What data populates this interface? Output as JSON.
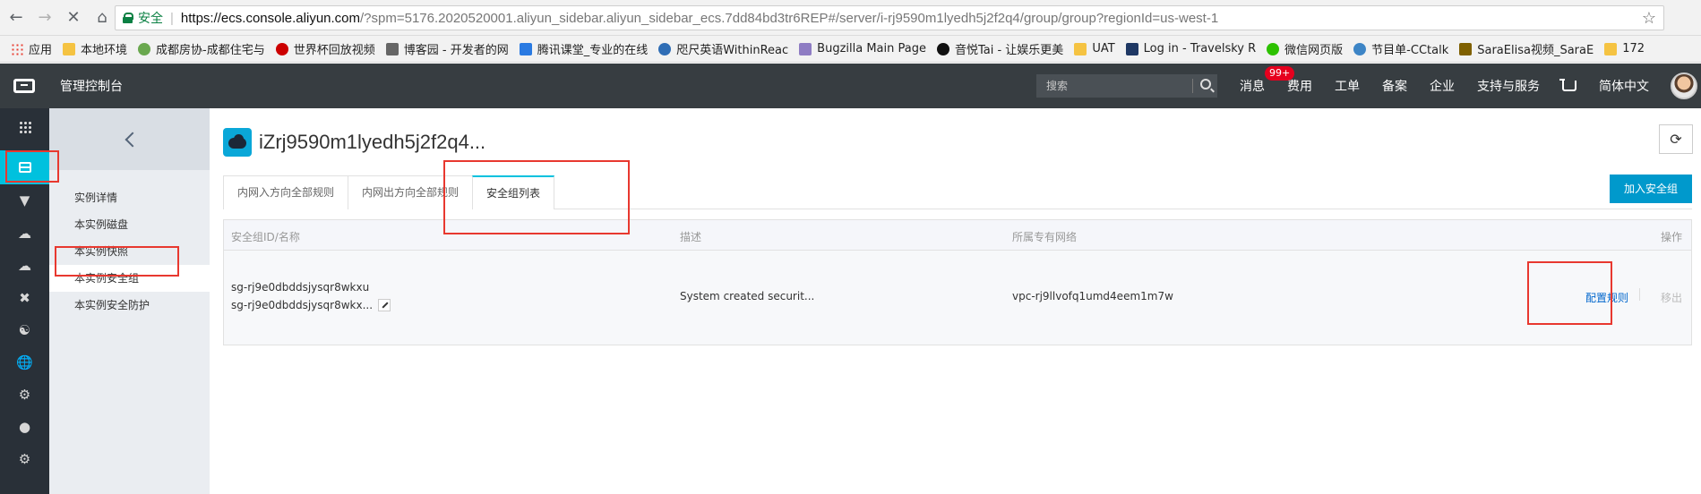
{
  "browser": {
    "secure_label": "安全",
    "url_host": "https://ecs.console.aliyun.com",
    "url_path": "/?spm=5176.2020520001.aliyun_sidebar.aliyun_sidebar_ecs.7dd84bd3tr6REP#/server/i-rj9590m1lyedh5j2f2q4/group/group?regionId=us-west-1",
    "bookmarks": [
      {
        "label": "应用"
      },
      {
        "label": "本地环境"
      },
      {
        "label": "成都房协-成都住宅与"
      },
      {
        "label": "世界杯回放视频"
      },
      {
        "label": "博客园 - 开发者的网"
      },
      {
        "label": "腾讯课堂_专业的在线"
      },
      {
        "label": "咫尺英语WithinReac"
      },
      {
        "label": "Bugzilla Main Page"
      },
      {
        "label": "音悦Tai - 让娱乐更美"
      },
      {
        "label": "UAT"
      },
      {
        "label": "Log in - Travelsky R"
      },
      {
        "label": "微信网页版"
      },
      {
        "label": "节目单-CCtalk"
      },
      {
        "label": "SaraElisa视频_SaraE"
      },
      {
        "label": "172"
      }
    ]
  },
  "topbar": {
    "console_title": "管理控制台",
    "search_placeholder": "搜索",
    "nav": {
      "messages": "消息",
      "messages_badge": "99+",
      "billing": "费用",
      "tickets": "工单",
      "icp": "备案",
      "enterprise": "企业",
      "support": "支持与服务",
      "language": "简体中文"
    }
  },
  "subnav": {
    "items": [
      {
        "label": "实例详情"
      },
      {
        "label": "本实例磁盘"
      },
      {
        "label": "本实例快照"
      },
      {
        "label": "本实例安全组"
      },
      {
        "label": "本实例安全防护"
      }
    ]
  },
  "main": {
    "title": "iZrj9590m1lyedh5j2f2q4...",
    "tabs": [
      {
        "label": "内网入方向全部规则"
      },
      {
        "label": "内网出方向全部规则"
      },
      {
        "label": "安全组列表"
      }
    ],
    "add_button": "加入安全组",
    "table": {
      "headers": {
        "id": "安全组ID/名称",
        "desc": "描述",
        "vpc": "所属专有网络",
        "ops": "操作"
      },
      "row": {
        "id": "sg-rj9e0dbddsjysqr8wkxu",
        "name": "sg-rj9e0dbddsjysqr8wkx...",
        "desc": "System created securit...",
        "vpc": "vpc-rj9llvofq1umd4eem1m7w",
        "configure": "配置规则",
        "remove": "移出"
      }
    }
  }
}
